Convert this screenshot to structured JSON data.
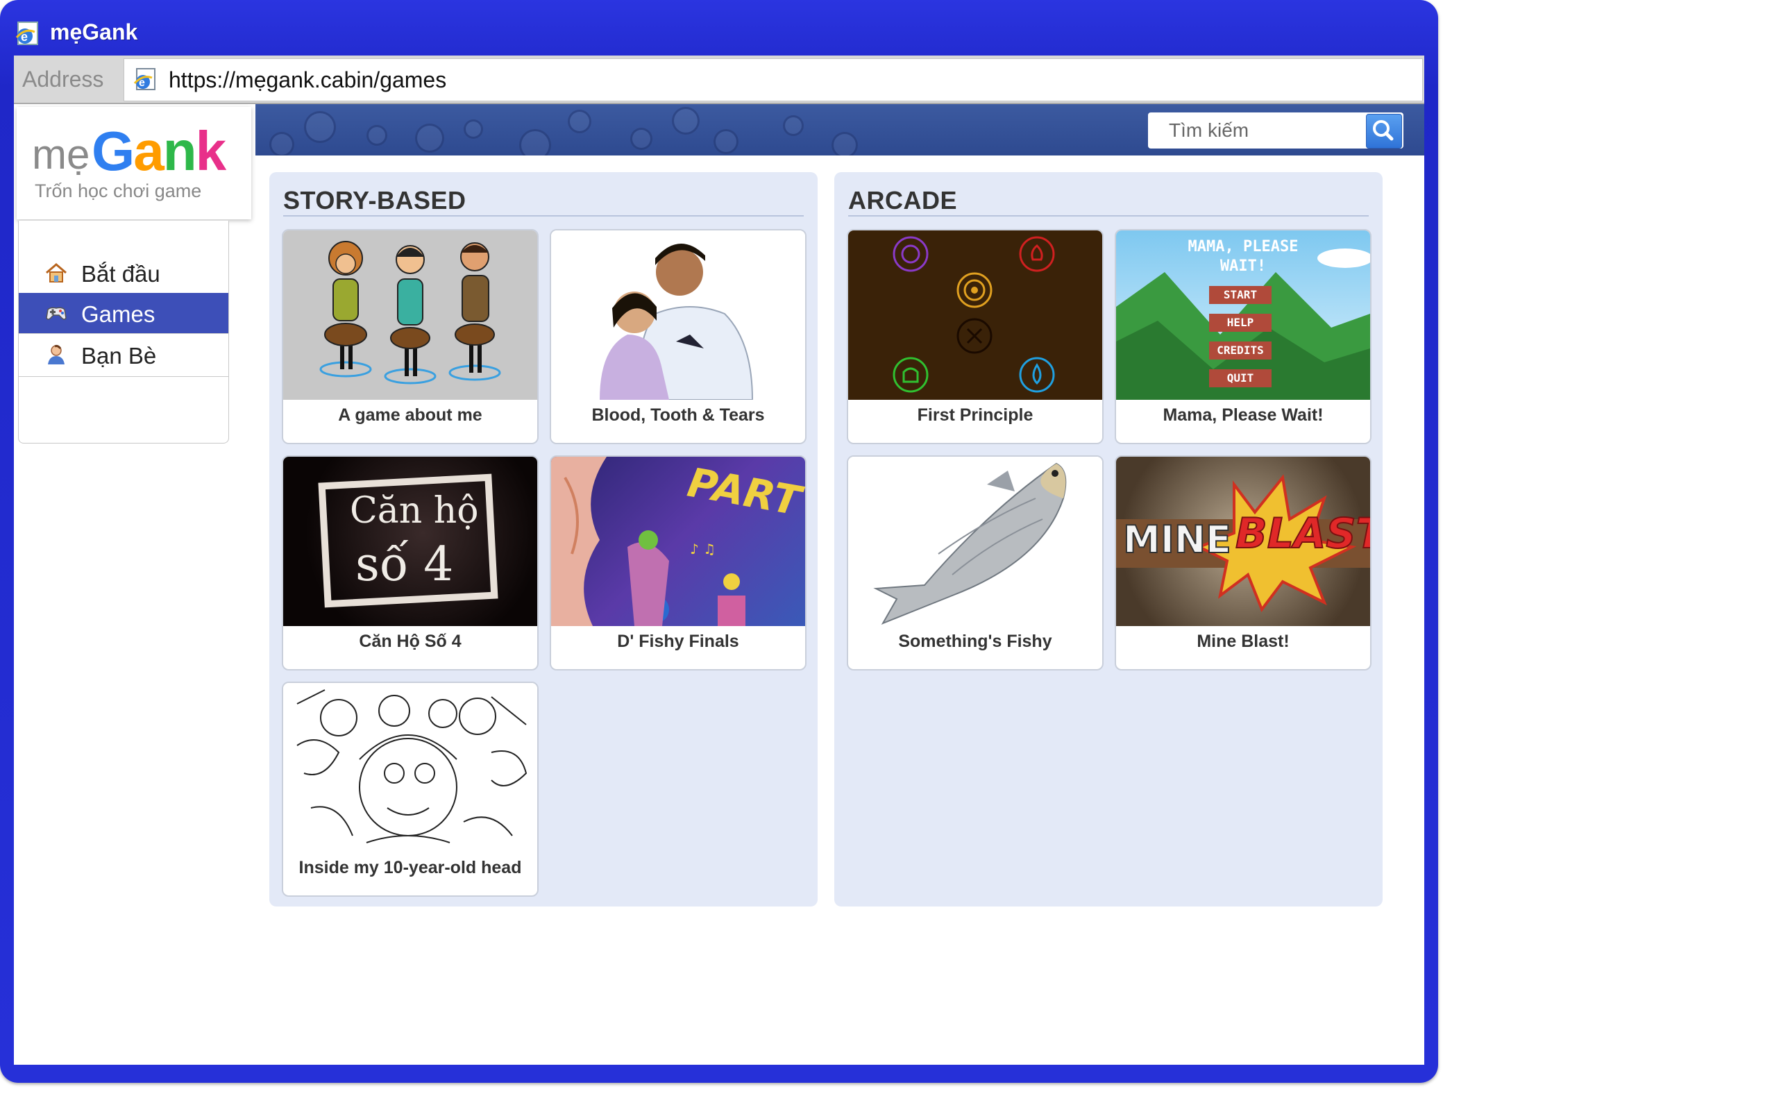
{
  "window": {
    "title": "mẹGank"
  },
  "address": {
    "label": "Address",
    "url": "https://mẹgank.cabin/games"
  },
  "site": {
    "logo_me": "mẹ",
    "logo_letters": [
      "G",
      "a",
      "n",
      "k"
    ],
    "logo_colors": [
      "#2f7ff0",
      "#ff9c00",
      "#2eb84a",
      "#e8308a"
    ],
    "tagline": "Trốn học chơi game",
    "search_placeholder": "Tìm kiếm"
  },
  "nav": {
    "items": [
      {
        "label": "Bắt đầu",
        "icon": "home-icon",
        "active": false
      },
      {
        "label": "Games",
        "icon": "gamepad-icon",
        "active": true
      },
      {
        "label": "Bạn Bè",
        "icon": "person-icon",
        "active": false
      }
    ]
  },
  "sections": [
    {
      "title": "STORY-BASED",
      "games": [
        {
          "title": "A game about me"
        },
        {
          "title": "Blood, Tooth & Tears"
        },
        {
          "title": "Căn Hộ Số 4",
          "thumb_text_1": "Căn hộ",
          "thumb_text_2": "số 4"
        },
        {
          "title": "D' Fishy Finals",
          "thumb_text": "PARTY"
        },
        {
          "title": "Inside my 10-year-old head"
        }
      ]
    },
    {
      "title": "ARCADE",
      "games": [
        {
          "title": "First Principle"
        },
        {
          "title": "Mama, Please Wait!",
          "thumb_title": "MAMA, PLEASE WAIT!",
          "menu": [
            "START",
            "HELP",
            "CREDITS",
            "QUIT"
          ]
        },
        {
          "title": "Something's Fishy"
        },
        {
          "title": "Mine Blast!",
          "thumb_text_1": "MINE",
          "thumb_text_2": "BLAST!"
        }
      ]
    }
  ]
}
